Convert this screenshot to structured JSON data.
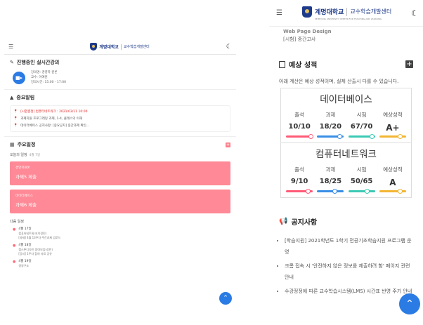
{
  "left": {
    "header": {
      "logo_main": "계명대학교",
      "logo_sub": "교수학습개발센터"
    },
    "live": {
      "title": "진행중인 실시간강의",
      "lines": [
        "강의명: 경영학 원론",
        "교수: 이예원",
        "강의시간: 15:00 - 17:00"
      ]
    },
    "notice": {
      "title": "중요알림",
      "items": [
        "[시험결정] 컴퓨터네트워크 : 2021/03/11 10:00",
        "과제지원 프로그래밍 과제, 1-4, 클래스의 이해",
        "데이터베이스 공지사항: [중요공지] 중간과제 확인..."
      ]
    },
    "schedule": {
      "title": "주요일정",
      "today_label": "오늘의 일정",
      "today_date": "4월 7일",
      "cards": [
        {
          "sub": "경영학원론",
          "task": "과제5 제출"
        },
        {
          "sub": "데이터베이스",
          "task": "과제6 제출"
        }
      ],
      "next_label": "다음 일정",
      "next": [
        {
          "date": "4월 17일",
          "l1": "컴퓨터네트워크(이정민)",
          "l2": "[과제] 4월 13주차 주간과제 업로드"
        },
        {
          "date": "4월 18일",
          "l1": "캡스톤디자인 참여모임(성빈)",
          "l2": "[공지] 1주차 참여 자료 공유"
        },
        {
          "date": "4월 19일",
          "l1": "경영구조",
          "l2": ""
        }
      ]
    }
  },
  "right": {
    "header": {
      "logo_main": "계명대학교",
      "logo_sub": "교수학습개발센터",
      "logo_en": "KEIMYUNG UNIVERSITY   CENTER FOR TEACHING AND LEARNING"
    },
    "course_tail": [
      "Web Page Design",
      "[시험] 중간고사"
    ],
    "grades": {
      "title": "예상 성적",
      "note": "아래 계산은 예상 성적이며, 실제 산출시 다를 수 있습니다.",
      "headers": [
        "출석",
        "과제",
        "시험",
        "예상성적"
      ],
      "subjects": [
        {
          "name": "데이터베이스",
          "values": [
            "10/10",
            "18/20",
            "67/70",
            "A+"
          ]
        },
        {
          "name": "컴퓨터네트워크",
          "values": [
            "9/10",
            "18/25",
            "50/65",
            "A"
          ]
        }
      ],
      "bar_colors": [
        "#ff5a78",
        "#3a8ee6",
        "#3cc9b4",
        "#f2b632"
      ]
    },
    "notices": {
      "title": "공지사항",
      "items": [
        "[학습지원] 2021학년도 1학기 전공기초학습지원 프로그램 운영",
        "크롬 접속 시 '안전하지 않은 정보를 제출하려 함' 페이지 관련 안내",
        "수강정정에 따른 교수학습시스템(LMS) 시간표 반영 주기 안내"
      ]
    }
  }
}
